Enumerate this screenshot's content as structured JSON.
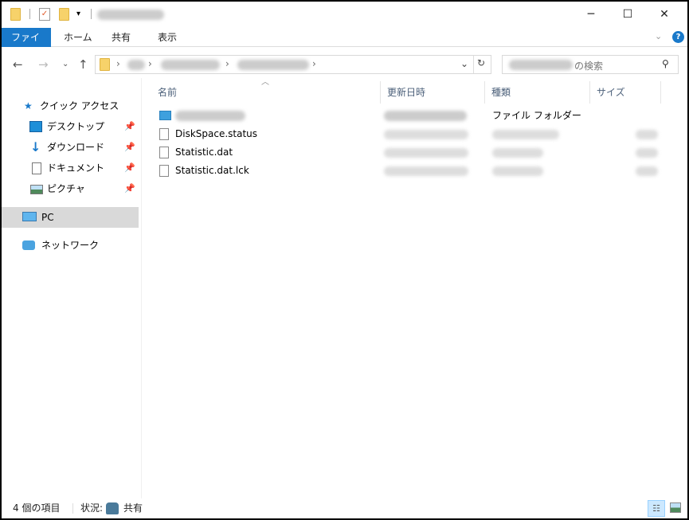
{
  "ribbon": {
    "tabs": [
      "ファイル",
      "ホーム",
      "共有",
      "表示"
    ]
  },
  "window_controls": {
    "minimize": "─",
    "maximize": "☐",
    "close": "✕"
  },
  "search": {
    "placeholder_suffix": "の検索"
  },
  "sidebar": {
    "quick_access": "クイック アクセス",
    "items": [
      {
        "label": "デスクトップ"
      },
      {
        "label": "ダウンロード"
      },
      {
        "label": "ドキュメント"
      },
      {
        "label": "ピクチャ"
      }
    ],
    "pc": "PC",
    "network": "ネットワーク"
  },
  "columns": [
    "名前",
    "更新日時",
    "種類",
    "サイズ"
  ],
  "files": [
    {
      "name": "",
      "type": "ファイル フォルダー",
      "icon": "folder-icon"
    },
    {
      "name": "DiskSpace.status",
      "type": "",
      "icon": "file-icon"
    },
    {
      "name": "Statistic.dat",
      "type": "",
      "icon": "file-icon"
    },
    {
      "name": "Statistic.dat.lck",
      "type": "",
      "icon": "file-icon"
    }
  ],
  "status": {
    "count": "4 個の項目",
    "state_label": "状況:",
    "state": "共有"
  },
  "colors": {
    "accent": "#1979ca",
    "selected": "#d9d9d9"
  }
}
